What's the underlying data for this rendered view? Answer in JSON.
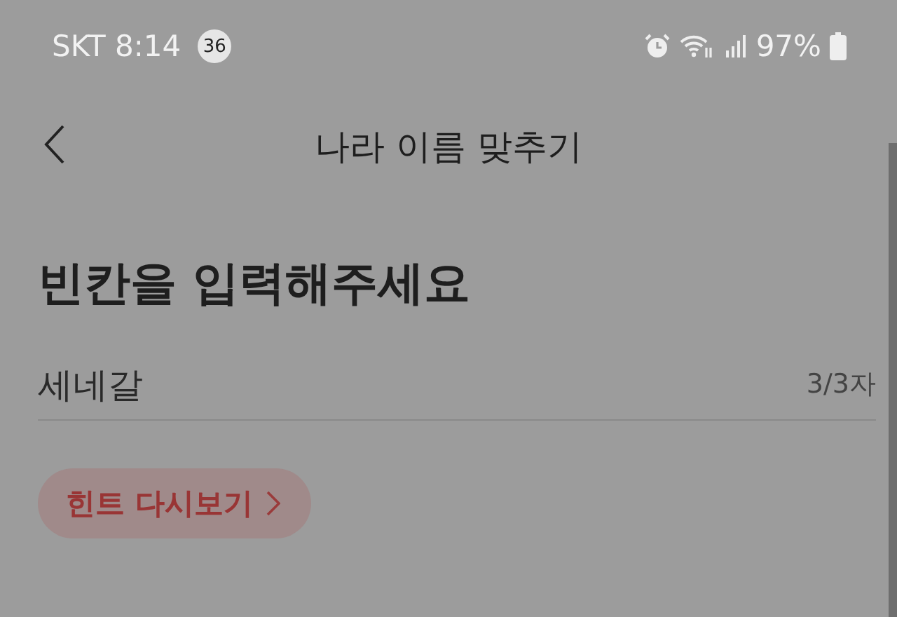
{
  "status_bar": {
    "carrier": "SKT",
    "time": "8:14",
    "notification_count": "36",
    "battery": "97%"
  },
  "header": {
    "title": "나라 이름 맞추기"
  },
  "prompt": "빈칸을 입력해주세요",
  "field": {
    "value": "세네갈",
    "counter": "3/3자"
  },
  "hint_button": {
    "label": "힌트 다시보기"
  }
}
